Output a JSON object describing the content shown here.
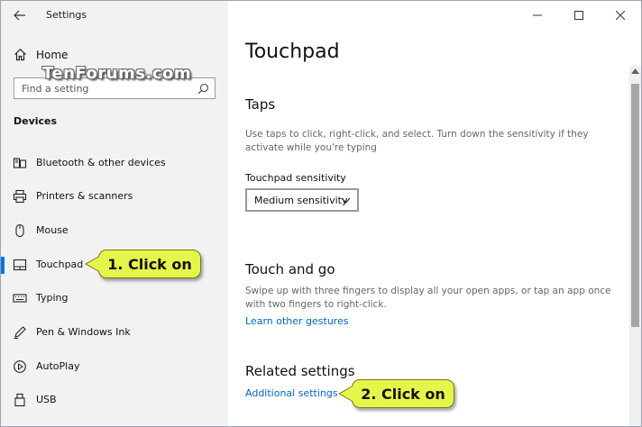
{
  "window": {
    "title": "Settings",
    "controls": {
      "minimize": "minimize-icon",
      "maximize": "maximize-icon",
      "close": "close-icon"
    }
  },
  "sidebar": {
    "home_label": "Home",
    "watermark": "TenForums.com",
    "search": {
      "placeholder": "Find a setting",
      "value": ""
    },
    "section": "Devices",
    "items": [
      {
        "label": "Bluetooth & other devices",
        "icon": "bluetooth-devices-icon"
      },
      {
        "label": "Printers & scanners",
        "icon": "printer-icon"
      },
      {
        "label": "Mouse",
        "icon": "mouse-icon"
      },
      {
        "label": "Touchpad",
        "icon": "touchpad-icon",
        "selected": true
      },
      {
        "label": "Typing",
        "icon": "keyboard-icon"
      },
      {
        "label": "Pen & Windows Ink",
        "icon": "pen-icon"
      },
      {
        "label": "AutoPlay",
        "icon": "autoplay-icon"
      },
      {
        "label": "USB",
        "icon": "usb-icon"
      }
    ]
  },
  "main": {
    "title": "Touchpad",
    "taps": {
      "heading": "Taps",
      "description": "Use taps to click, right-click, and select. Turn down the sensitivity if they activate while you're typing",
      "sensitivity_label": "Touchpad sensitivity",
      "sensitivity_value": "Medium sensitivity"
    },
    "touch_and_go": {
      "heading": "Touch and go",
      "description": "Swipe up with three fingers to display all your open apps, or tap an app once with two fingers to right-click.",
      "link": "Learn other gestures"
    },
    "related": {
      "heading": "Related settings",
      "link": "Additional settings"
    }
  },
  "callouts": {
    "first": "1. Click on",
    "second": "2. Click on",
    "color": "#e6f54a"
  },
  "colors": {
    "accent": "#0078d7",
    "link": "#0067c0",
    "sidebar_bg": "#f2f2f2"
  }
}
